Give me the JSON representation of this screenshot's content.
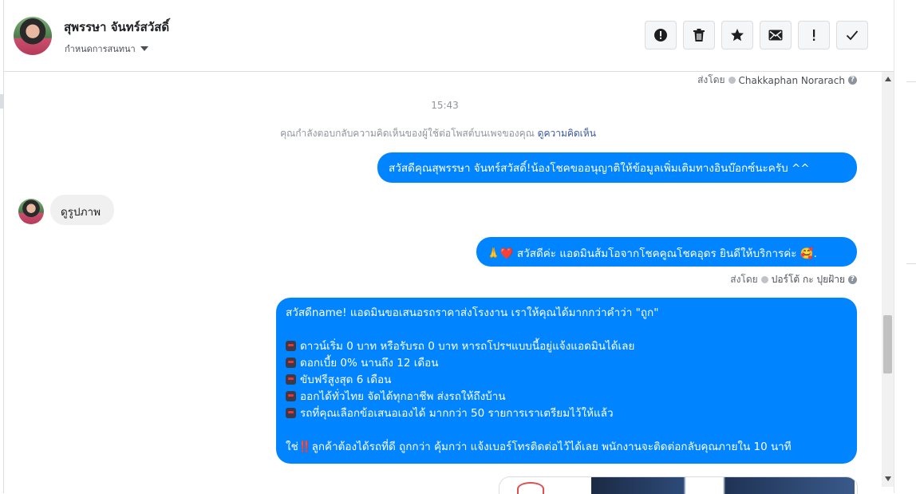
{
  "header": {
    "contact_name": "สุพรรษา จันทร์สวัสดิ์",
    "subtitle": "กำหนดการสนทนา",
    "actions": [
      {
        "name": "report-icon",
        "label": "!"
      },
      {
        "name": "trash-icon"
      },
      {
        "name": "star-icon"
      },
      {
        "name": "mail-icon"
      },
      {
        "name": "exclamation-icon",
        "label": "!"
      },
      {
        "name": "check-icon"
      }
    ]
  },
  "thread": {
    "sent_by_prefix": "ส่งโดย",
    "sent_by_1": "Chakkaphan Norarach",
    "time": "15:43",
    "context_text": "คุณกำลังตอบกลับความคิดเห็นของผู้ใช้ต่อโพสต์บนเพจของคุณ",
    "context_link": "ดูความคิดเห็น",
    "msg_out_1": "สวัสดีคุณสุพรรษา จันทร์สวัสดิ์!น้องโชคขออนุญาติให้ข้อมูลเพิ่มเติมทางอินบ๊อกซ์นะครับ ^^",
    "msg_in_1": "ดูรูปภาพ",
    "msg_out_2": "สวัสดีค่ะ แอดมินส้มโอจากโชคคูณโชคอุดร ยินดีให้บริการค่ะ",
    "msg_out_2_prefix_emoji": "🙏❤️",
    "msg_out_2_suffix_emoji": "🥰.",
    "sent_by_2": "ปอร์โต้ กะ ปุยฝ้าย",
    "msg_out_3": {
      "intro": "สวัสดีname! แอดมินขอเสนอรถราคาส่งโรงงาน เราให้คุณได้มากกว่าคำว่า \"ถูก\"",
      "bullets": [
        "ดาวน์เริ่ม 0 บาท หรือรับรถ 0 บาท หารถโปรฯแบบนี้อยู่แจ้งแอดมินได้เลย",
        "ดอกเบี้ย 0% นานถึง 12 เดือน",
        "ขับฟรีสูงสุด 6 เดือน",
        "ออกได้ทั่วไทย จัดได้ทุกอาชีพ ส่งรถให้ถึงบ้าน",
        "รถที่คุณเลือกข้อเสนอเองได้ มากกว่า 50 รายการเราเตรียมไว้ให้แล้ว"
      ],
      "closing_prefix": "ใช่",
      "closing_emoji": "‼️",
      "closing": "ลูกค้าต้องได้รถที่ดี ถูกกว่า คุ้มกว่า แจ้งเบอร์โทรติดต่อไว้ได้เลย พนักงานจะติดต่อกลับคุณภายใน 10 นาที"
    }
  },
  "colors": {
    "outgoing_bubble": "#0084ff",
    "incoming_bubble": "#f1f0f0",
    "link": "#385898"
  }
}
